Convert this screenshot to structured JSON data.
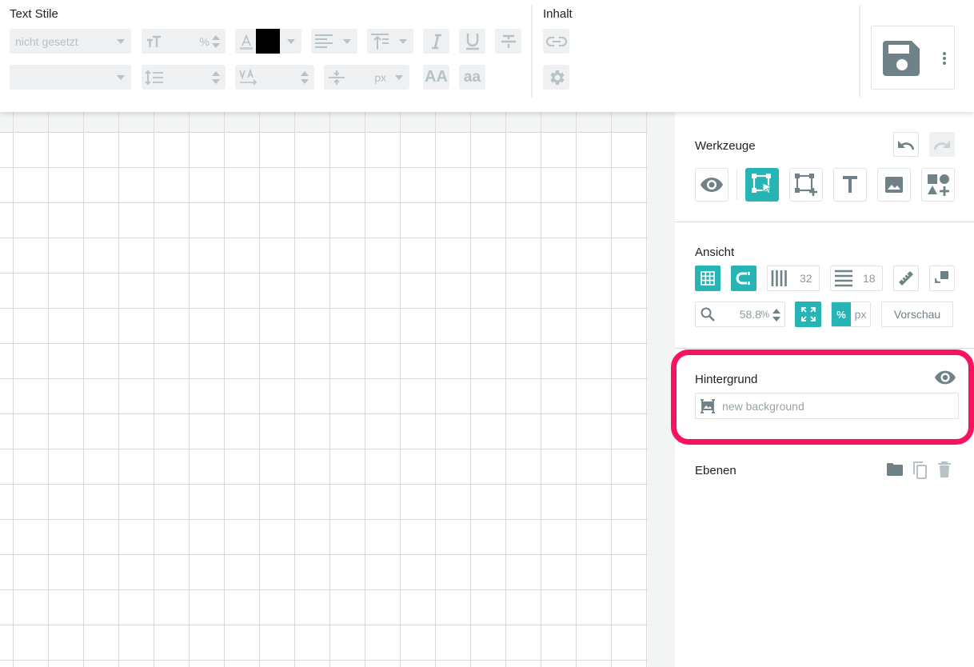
{
  "toolbar": {
    "text_style_title": "Text Stile",
    "font_select_value": "nicht gesetzt",
    "font_size_unit": "%",
    "letter_spacing_unit": "px",
    "caps_label": "AA",
    "lower_label": "aa",
    "content_title": "Inhalt",
    "text_color": "#000000"
  },
  "panel": {
    "tools_title": "Werkzeuge",
    "view_title": "Ansicht",
    "columns_value": "32",
    "rows_value": "18",
    "zoom_value": "58.8",
    "zoom_unit": "%",
    "unit_percent": "%",
    "unit_px": "px",
    "preview_label": "Vorschau",
    "background_title": "Hintergrund",
    "background_placeholder": "new background",
    "layers_title": "Ebenen"
  },
  "colors": {
    "accent": "#26b4b4",
    "highlight": "#f7145c",
    "icon_gray": "#6e8287"
  }
}
